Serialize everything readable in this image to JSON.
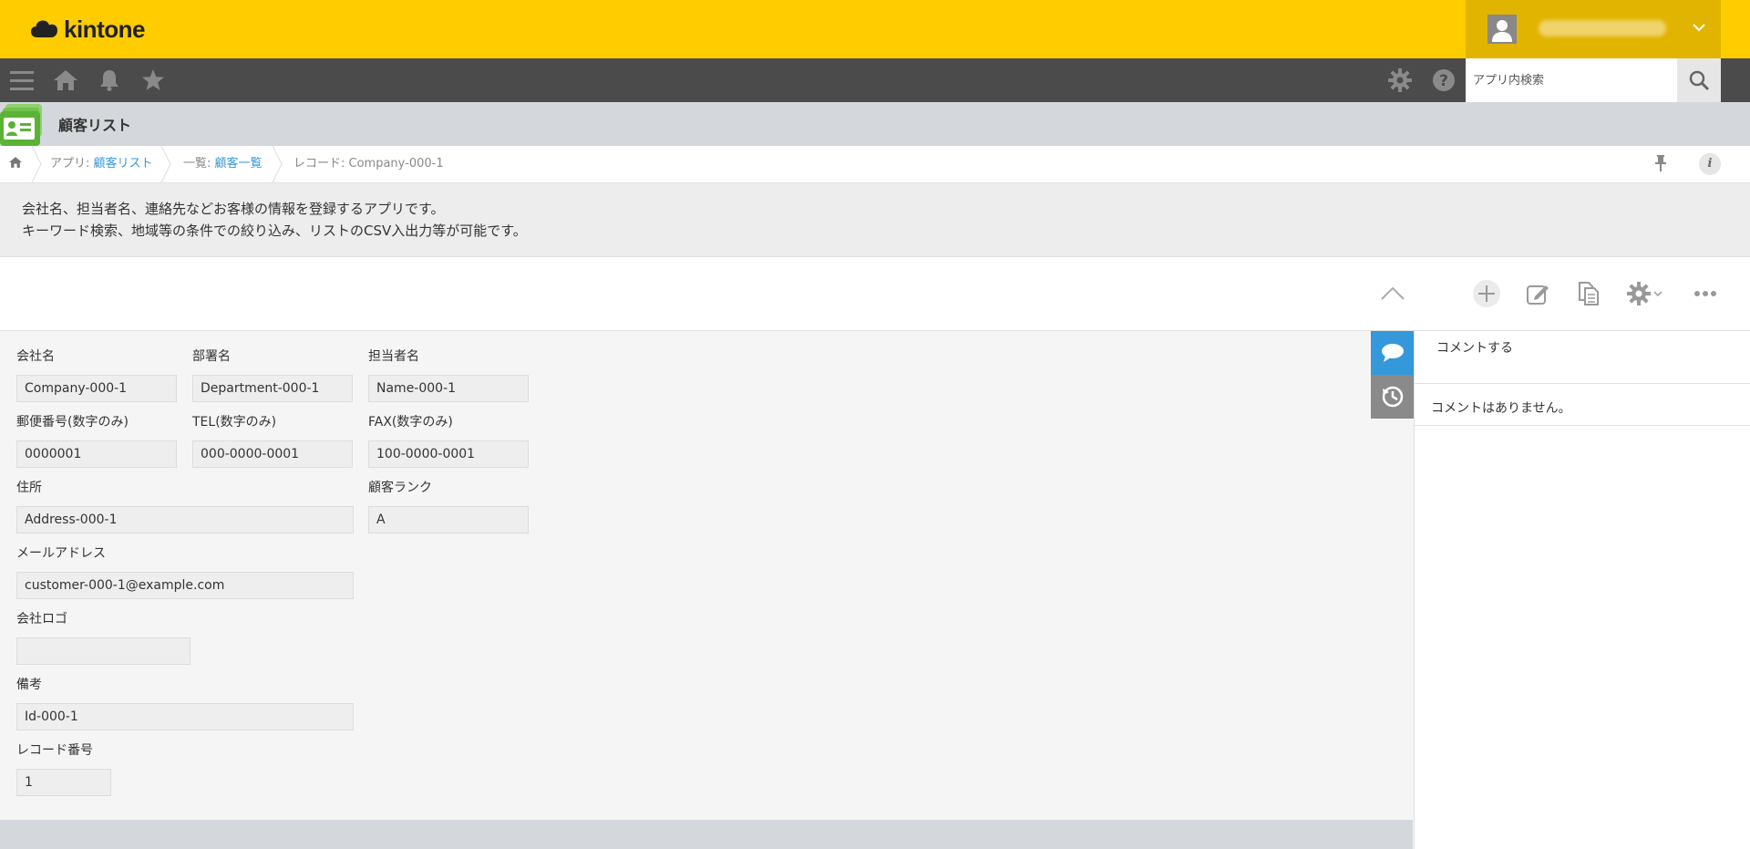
{
  "header": {
    "logo_text": "kintone",
    "brand_color": "#ffcc00",
    "user_avatar_icon": "user-icon",
    "user_menu_icon": "chevron-down-icon"
  },
  "nav": {
    "icons": [
      "menu-icon",
      "home-icon",
      "bell-icon",
      "star-icon",
      "gear-icon",
      "help-icon"
    ],
    "search_placeholder": "アプリ内検索",
    "search_icon": "search-icon"
  },
  "app": {
    "title": "顧客リスト",
    "icon": "contact-card-icon"
  },
  "breadcrumb": {
    "app_prefix": "アプリ: ",
    "app_link": "顧客リスト",
    "list_prefix": "一覧: ",
    "list_link": "顧客一覧",
    "record": "レコード: Company-000-1"
  },
  "description": {
    "line1": "会社名、担当者名、連絡先などお客様の情報を登録するアプリです。",
    "line2": "キーワード検索、地域等の条件での絞り込み、リストのCSV入出力等が可能です。"
  },
  "toolbar": {
    "icons": [
      "collapse-up-icon",
      "add-record-icon",
      "edit-icon",
      "duplicate-icon",
      "settings-gear-icon",
      "more-options-icon"
    ]
  },
  "fields": {
    "company": {
      "label": "会社名",
      "value": "Company-000-1"
    },
    "department": {
      "label": "部署名",
      "value": "Department-000-1"
    },
    "person": {
      "label": "担当者名",
      "value": "Name-000-1"
    },
    "zip": {
      "label": "郵便番号(数字のみ)",
      "value": "0000001"
    },
    "tel": {
      "label": "TEL(数字のみ)",
      "value": "000-0000-0001"
    },
    "fax": {
      "label": "FAX(数字のみ)",
      "value": "100-0000-0001"
    },
    "address": {
      "label": "住所",
      "value": "Address-000-1"
    },
    "rank": {
      "label": "顧客ランク",
      "value": "A"
    },
    "email": {
      "label": "メールアドレス",
      "value": "customer-000-1@example.com"
    },
    "logo": {
      "label": "会社ロゴ",
      "value": ""
    },
    "notes": {
      "label": "備考",
      "value": "Id-000-1"
    },
    "record_no": {
      "label": "レコード番号",
      "value": "1"
    }
  },
  "comments": {
    "tab_icons": [
      "comment-icon",
      "history-icon"
    ],
    "input_placeholder": "コメントする",
    "empty_text": "コメントはありません。",
    "active_tab_color": "#3498db"
  }
}
